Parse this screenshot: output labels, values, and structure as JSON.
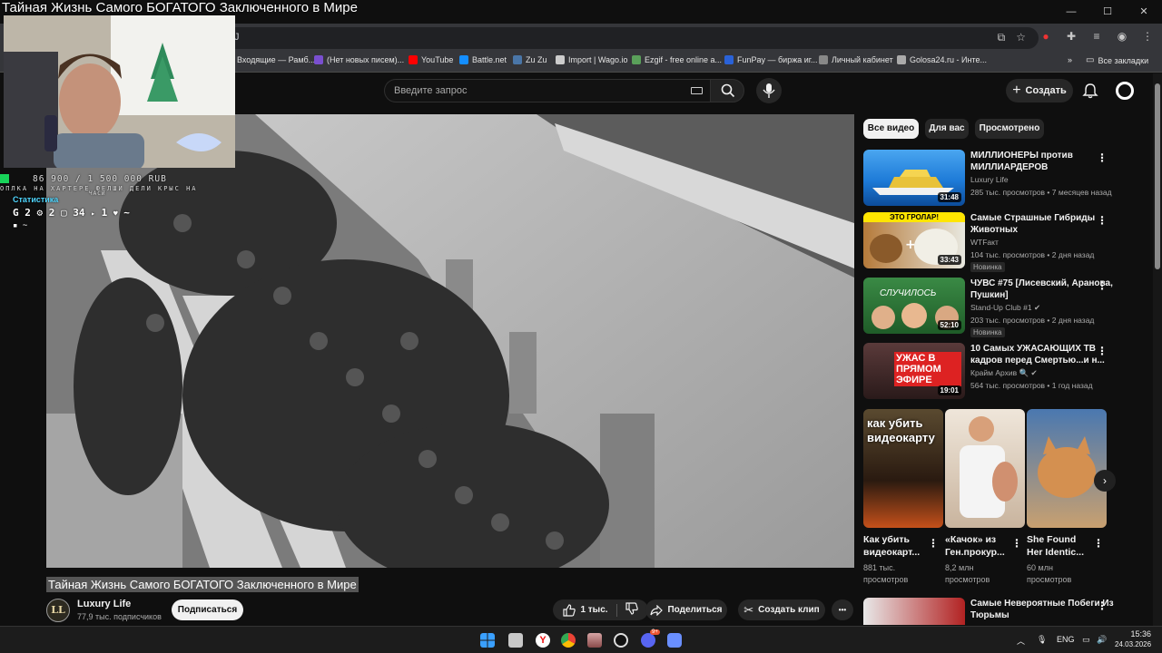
{
  "stream_title": "Тайная Жизнь Самого БОГАТОГО Заключенного в Мире",
  "window_controls": {
    "minimize": "—",
    "maximize": "☐",
    "close": "✕"
  },
  "address": {
    "url": "J"
  },
  "bookmarks": [
    {
      "label": "Входящие — Рамб...",
      "color": "#3a6fd8"
    },
    {
      "label": "(Нет новых писем)...",
      "color": "#7a4fd0"
    },
    {
      "label": "YouTube",
      "color": "#ff0000"
    },
    {
      "label": "Battle.net",
      "color": "#148eff"
    },
    {
      "label": "Zu Zu",
      "color": "#4a76a8"
    },
    {
      "label": "Import | Wago.io",
      "color": "#cccccc"
    },
    {
      "label": "Ezgif - free online a...",
      "color": "#5aa05a"
    },
    {
      "label": "FunPay — биржа иг...",
      "color": "#2a62d8"
    },
    {
      "label": "Личный кабинет",
      "color": "#888888"
    },
    {
      "label": "Golosa24.ru - Инте...",
      "color": "#aaaaaa"
    }
  ],
  "bookmarks_all": "Все закладки",
  "search": {
    "placeholder": "Введите запрос"
  },
  "header": {
    "create_label": "Создать"
  },
  "video": {
    "title": "Тайная Жизнь Самого БОГАТОГО Заключенного в Мире",
    "channel": "Luxury Life",
    "channel_initials": "LL",
    "subscribers": "77,9 тыс. подписчиков",
    "subscribe_label": "Подписаться",
    "likes": "1 тыс.",
    "share_label": "Поделиться",
    "clip_label": "Создать клип",
    "more_label": "•••"
  },
  "chips": [
    "Все видео",
    "Для вас",
    "Просмотрено"
  ],
  "recommendations": [
    {
      "title": "МИЛЛИОНЕРЫ против МИЛЛИАРДЕРОВ",
      "channel": "Luxury Life",
      "meta": "285 тыс. просмотров • 7 месяцев назад",
      "duration": "31:48",
      "badge": "",
      "thumb_color": "#1e7bd8"
    },
    {
      "title": "Самые Страшные Гибриды Животных",
      "channel": "WTFакт",
      "meta": "104 тыс. просмотров • 2 дня назад",
      "duration": "33:43",
      "badge": "Новинка",
      "thumb_color": "#c79a3a",
      "thumb_text": "ЭТО ГРОЛАР!"
    },
    {
      "title": "ЧУВС #75 [Лисевский, Аранова, Пушкин]",
      "channel": "Stand-Up Club #1",
      "meta": "203 тыс. просмотров • 2 дня назад",
      "duration": "52:10",
      "badge": "Новинка",
      "thumb_color": "#2f7d3a",
      "thumb_text": "СЛУЧИЛОСЬ"
    },
    {
      "title": "10 Самых УЖАСАЮЩИХ ТВ кадров перед Смертью...и н...",
      "channel": "Крайм Архив 🔍",
      "meta": "564 тыс. просмотров • 1 год назад",
      "duration": "19:01",
      "badge": "",
      "thumb_color": "#7a2a2a",
      "thumb_text": "УЖАС В ПРЯМОМ ЭФИРЕ"
    },
    {
      "title": "Самые Невероятные Побеги Из Тюрьмы",
      "channel": "",
      "meta": "",
      "duration": "",
      "badge": "",
      "thumb_color": "#b22222"
    }
  ],
  "shorts": [
    {
      "title": "Как убить видеокарт...",
      "views_line1": "881 тыс.",
      "views_line2": "просмотров",
      "thumb_text": "как убить видеокарту",
      "thumb_color": "#3a2a1a"
    },
    {
      "title": "«Качок» из Ген.прокур...",
      "views_line1": "8,2 млн",
      "views_line2": "просмотров",
      "thumb_color": "#d8c8b8"
    },
    {
      "title": "She Found Her Identic...",
      "views_line1": "60 млн",
      "views_line2": "просмотров",
      "thumb_color": "#c8a070"
    }
  ],
  "overlay": {
    "donation": "86 900 / 1 500 000 RUB",
    "ticker": "ОПЛКА НА ХАРТЕРЕ ФЕЛШИ ДЕЛИ КРЫС НА",
    "ticker2": "ЧАСИ",
    "stats_label": "Статистика",
    "stats": [
      "2",
      "2",
      "34",
      "1",
      "~",
      "~"
    ]
  },
  "taskbar": {
    "lang": "ENG",
    "time": "15:36",
    "date": "24.03.2026",
    "discord_badge": "9+"
  }
}
